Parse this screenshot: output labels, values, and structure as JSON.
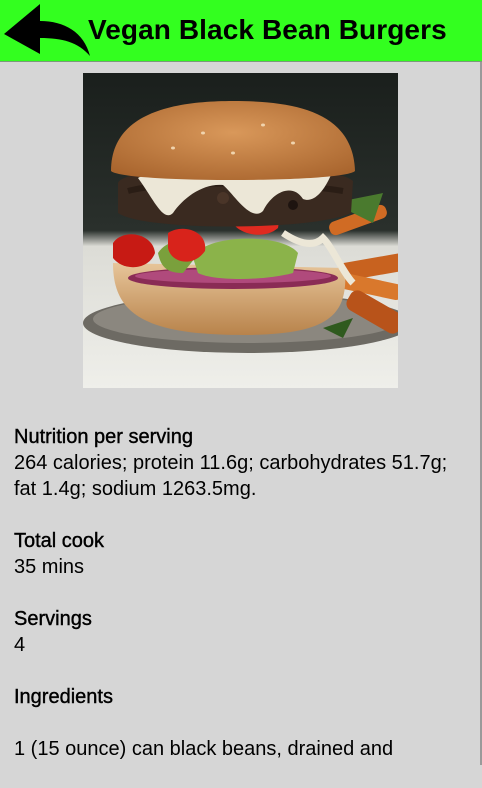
{
  "header": {
    "title": "Vegan Black Bean Burgers",
    "back_icon": "back-arrow-icon",
    "background_color": "#33ff1f"
  },
  "image": {
    "subject": "black bean burger with avocado, tomato, red onion and sauce on a plate with sweet potato fries"
  },
  "nutrition": {
    "heading": "Nutrition per serving",
    "text": "264 calories; protein 11.6g; carbohydrates 51.7g; fat 1.4g; sodium 1263.5mg."
  },
  "total_cook": {
    "heading": "Total cook",
    "value": "35 mins"
  },
  "servings": {
    "heading": "Servings",
    "value": "4"
  },
  "ingredients": {
    "heading": "Ingredients",
    "items": [
      "1 (15 ounce) can black beans, drained and"
    ]
  }
}
